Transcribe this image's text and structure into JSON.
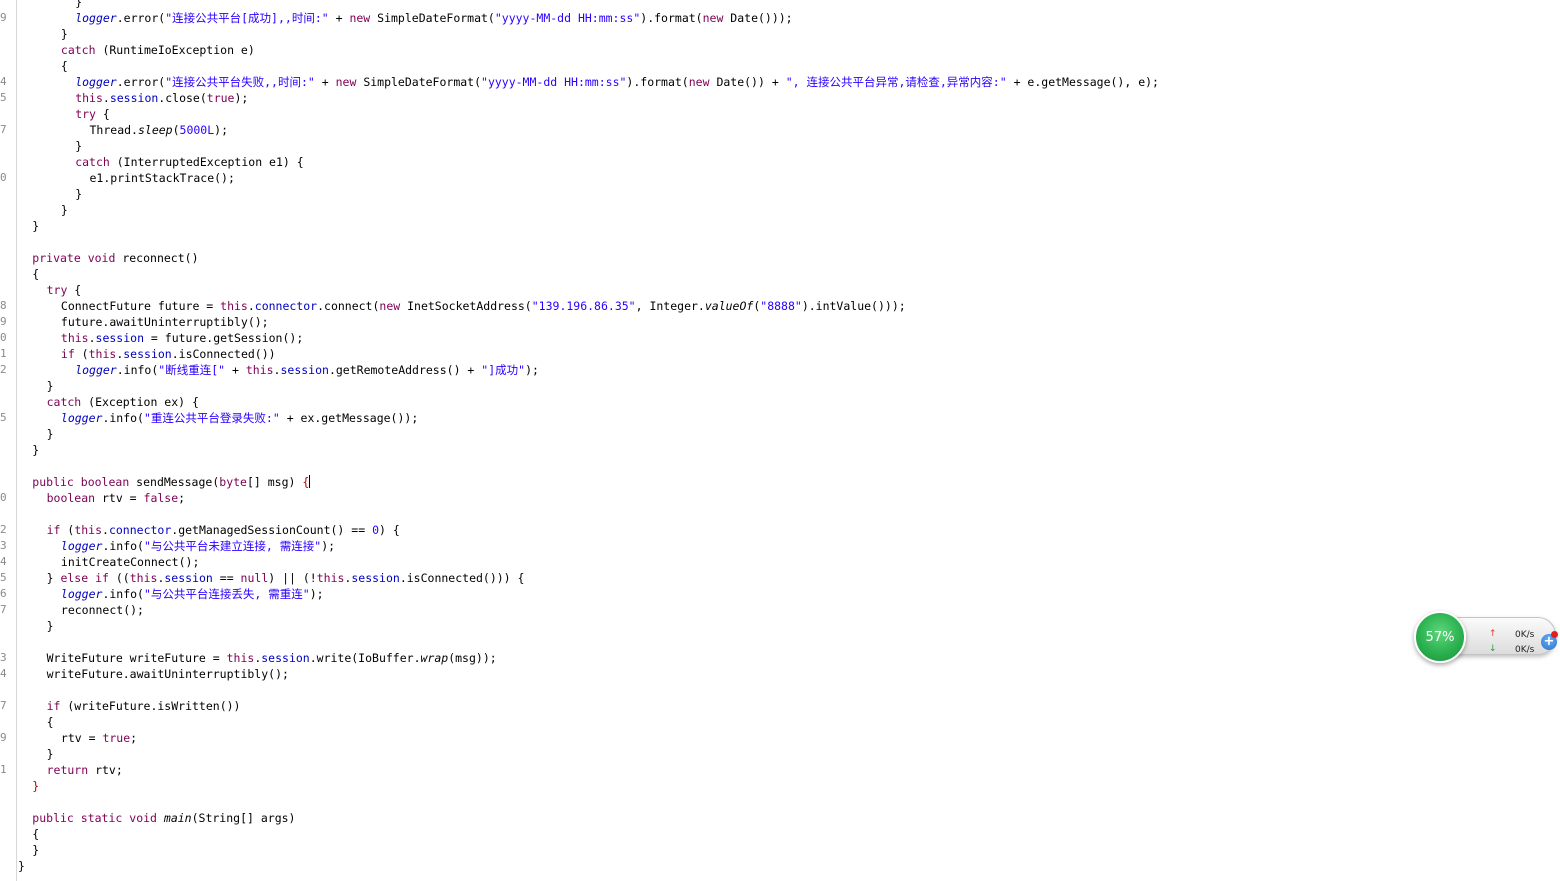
{
  "widget": {
    "usage_percent": "57%",
    "upload_rate": "0K/s",
    "download_rate": "0K/s",
    "colors": {
      "gauge": "#2bb24f",
      "upload_arrow": "#d83a2a",
      "download_arrow": "#2d9a45"
    }
  },
  "editor": {
    "lines": [
      {
        "ln": "",
        "indent": 4,
        "tokens": [
          [
            "",
            "}"
          ]
        ]
      },
      {
        "ln": "9",
        "indent": 4,
        "tokens": [
          [
            "lg",
            "logger"
          ],
          [
            "",
            ".error("
          ],
          [
            "str",
            "\"连接公共平台[成功],,时间:\""
          ],
          [
            "",
            " + "
          ],
          [
            "kw",
            "new"
          ],
          [
            "",
            " SimpleDateFormat("
          ],
          [
            "str",
            "\"yyyy-MM-dd HH:mm:ss\""
          ],
          [
            "",
            ")."
          ],
          [
            "",
            "format("
          ],
          [
            "kw",
            "new"
          ],
          [
            "",
            " Date()));"
          ]
        ]
      },
      {
        "ln": "",
        "indent": 3,
        "tokens": [
          [
            "",
            "}"
          ]
        ]
      },
      {
        "ln": "",
        "indent": 3,
        "tokens": [
          [
            "kw",
            "catch"
          ],
          [
            "",
            " (RuntimeIoException e)"
          ]
        ]
      },
      {
        "ln": "",
        "indent": 3,
        "tokens": [
          [
            "",
            "{"
          ]
        ]
      },
      {
        "ln": "4",
        "indent": 4,
        "tokens": [
          [
            "lg",
            "logger"
          ],
          [
            "",
            ".error("
          ],
          [
            "str",
            "\"连接公共平台失败,,时间:\""
          ],
          [
            "",
            " + "
          ],
          [
            "kw",
            "new"
          ],
          [
            "",
            " SimpleDateFormat("
          ],
          [
            "str",
            "\"yyyy-MM-dd HH:mm:ss\""
          ],
          [
            "",
            ").format("
          ],
          [
            "kw",
            "new"
          ],
          [
            "",
            " Date()) + "
          ],
          [
            "str",
            "\", 连接公共平台异常,请检查,异常内容:\""
          ],
          [
            "",
            " + e.getMessage(), e);"
          ]
        ]
      },
      {
        "ln": "5",
        "indent": 4,
        "tokens": [
          [
            "kw",
            "this"
          ],
          [
            "",
            "."
          ],
          [
            "fld",
            "session"
          ],
          [
            "",
            ".close("
          ],
          [
            "kw",
            "true"
          ],
          [
            "",
            ");"
          ]
        ]
      },
      {
        "ln": "",
        "indent": 4,
        "tokens": [
          [
            "kw",
            "try"
          ],
          [
            "",
            " {"
          ]
        ]
      },
      {
        "ln": "7",
        "indent": 5,
        "tokens": [
          [
            "",
            "Thread."
          ],
          [
            "it",
            "sleep"
          ],
          [
            "",
            "("
          ],
          [
            "str",
            "5000L"
          ],
          [
            "",
            ");"
          ]
        ]
      },
      {
        "ln": "",
        "indent": 4,
        "tokens": [
          [
            "",
            "}"
          ]
        ]
      },
      {
        "ln": "",
        "indent": 4,
        "tokens": [
          [
            "kw",
            "catch"
          ],
          [
            "",
            " (InterruptedException e1) {"
          ]
        ]
      },
      {
        "ln": "0",
        "indent": 5,
        "tokens": [
          [
            "",
            "e1.printStackTrace();"
          ]
        ]
      },
      {
        "ln": "",
        "indent": 4,
        "tokens": [
          [
            "",
            "}"
          ]
        ]
      },
      {
        "ln": "",
        "indent": 3,
        "tokens": [
          [
            "",
            "}"
          ]
        ]
      },
      {
        "ln": "",
        "indent": 1,
        "tokens": [
          [
            "",
            "}"
          ]
        ]
      },
      {
        "ln": "",
        "indent": 0,
        "tokens": []
      },
      {
        "ln": "",
        "indent": 1,
        "tokens": [
          [
            "kw",
            "private"
          ],
          [
            "",
            " "
          ],
          [
            "kw",
            "void"
          ],
          [
            "",
            " reconnect()"
          ]
        ]
      },
      {
        "ln": "",
        "indent": 1,
        "tokens": [
          [
            "",
            "{"
          ]
        ]
      },
      {
        "ln": "",
        "indent": 2,
        "tokens": [
          [
            "kw",
            "try"
          ],
          [
            "",
            " {"
          ]
        ]
      },
      {
        "ln": "8",
        "indent": 3,
        "tokens": [
          [
            "",
            "ConnectFuture future = "
          ],
          [
            "kw",
            "this"
          ],
          [
            "",
            "."
          ],
          [
            "fld",
            "connector"
          ],
          [
            "",
            ".connect("
          ],
          [
            "kw",
            "new"
          ],
          [
            "",
            " InetSocketAddress("
          ],
          [
            "str",
            "\"139.196.86.35\""
          ],
          [
            "",
            ", Integer."
          ],
          [
            "it",
            "valueOf"
          ],
          [
            "",
            "("
          ],
          [
            "str",
            "\"8888\""
          ],
          [
            "",
            ").intValue()));"
          ]
        ]
      },
      {
        "ln": "9",
        "indent": 3,
        "tokens": [
          [
            "",
            "future.awaitUninterruptibly();"
          ]
        ]
      },
      {
        "ln": "0",
        "indent": 3,
        "tokens": [
          [
            "kw",
            "this"
          ],
          [
            "",
            "."
          ],
          [
            "fld",
            "session"
          ],
          [
            "",
            " = future.getSession();"
          ]
        ]
      },
      {
        "ln": "1",
        "indent": 3,
        "tokens": [
          [
            "kw",
            "if"
          ],
          [
            "",
            " ("
          ],
          [
            "kw",
            "this"
          ],
          [
            "",
            "."
          ],
          [
            "fld",
            "session"
          ],
          [
            "",
            ".isConnected())"
          ]
        ]
      },
      {
        "ln": "2",
        "indent": 4,
        "tokens": [
          [
            "lg",
            "logger"
          ],
          [
            "",
            ".info("
          ],
          [
            "str",
            "\"断线重连[\""
          ],
          [
            "",
            " + "
          ],
          [
            "kw",
            "this"
          ],
          [
            "",
            "."
          ],
          [
            "fld",
            "session"
          ],
          [
            "",
            ".getRemoteAddress() + "
          ],
          [
            "str",
            "\"]成功\""
          ],
          [
            "",
            ");"
          ]
        ]
      },
      {
        "ln": "",
        "indent": 2,
        "tokens": [
          [
            "",
            "}"
          ]
        ]
      },
      {
        "ln": "",
        "indent": 2,
        "tokens": [
          [
            "kw",
            "catch"
          ],
          [
            "",
            " (Exception ex) {"
          ]
        ]
      },
      {
        "ln": "5",
        "indent": 3,
        "tokens": [
          [
            "lg",
            "logger"
          ],
          [
            "",
            ".info("
          ],
          [
            "str",
            "\"重连公共平台登录失败:\""
          ],
          [
            "",
            " + ex.getMessage());"
          ]
        ]
      },
      {
        "ln": "",
        "indent": 2,
        "tokens": [
          [
            "",
            "}"
          ]
        ]
      },
      {
        "ln": "",
        "indent": 1,
        "tokens": [
          [
            "",
            "}"
          ]
        ]
      },
      {
        "ln": "",
        "indent": 0,
        "tokens": []
      },
      {
        "ln": "",
        "indent": 1,
        "tokens": [
          [
            "kw",
            "public"
          ],
          [
            "",
            " "
          ],
          [
            "kw",
            "boolean"
          ],
          [
            "",
            " sendMessage("
          ],
          [
            "kw",
            "byte"
          ],
          [
            "",
            "[] msg) "
          ],
          [
            "br",
            "{"
          ],
          [
            "caret",
            ""
          ]
        ]
      },
      {
        "ln": "0",
        "indent": 2,
        "tokens": [
          [
            "kw",
            "boolean"
          ],
          [
            "",
            " rtv = "
          ],
          [
            "kw",
            "false"
          ],
          [
            "",
            ";"
          ]
        ]
      },
      {
        "ln": "",
        "indent": 0,
        "tokens": []
      },
      {
        "ln": "2",
        "indent": 2,
        "tokens": [
          [
            "kw",
            "if"
          ],
          [
            "",
            " ("
          ],
          [
            "kw",
            "this"
          ],
          [
            "",
            "."
          ],
          [
            "fld",
            "connector"
          ],
          [
            "",
            ".getManagedSessionCount() == "
          ],
          [
            "str",
            "0"
          ],
          [
            "",
            ") {"
          ]
        ]
      },
      {
        "ln": "3",
        "indent": 3,
        "tokens": [
          [
            "lg",
            "logger"
          ],
          [
            "",
            ".info("
          ],
          [
            "str",
            "\"与公共平台未建立连接, 需连接\""
          ],
          [
            "",
            ");"
          ]
        ]
      },
      {
        "ln": "4",
        "indent": 3,
        "tokens": [
          [
            "",
            "initCreateConnect();"
          ]
        ]
      },
      {
        "ln": "5",
        "indent": 2,
        "tokens": [
          [
            "",
            "} "
          ],
          [
            "kw",
            "else"
          ],
          [
            "",
            " "
          ],
          [
            "kw",
            "if"
          ],
          [
            "",
            " (("
          ],
          [
            "kw",
            "this"
          ],
          [
            "",
            "."
          ],
          [
            "fld",
            "session"
          ],
          [
            "",
            " == "
          ],
          [
            "kw",
            "null"
          ],
          [
            "",
            ") || (!"
          ],
          [
            "kw",
            "this"
          ],
          [
            "",
            "."
          ],
          [
            "fld",
            "session"
          ],
          [
            "",
            ".isConnected())) {"
          ]
        ]
      },
      {
        "ln": "6",
        "indent": 3,
        "tokens": [
          [
            "lg",
            "logger"
          ],
          [
            "",
            ".info("
          ],
          [
            "str",
            "\"与公共平台连接丢失, 需重连\""
          ],
          [
            "",
            ");"
          ]
        ]
      },
      {
        "ln": "7",
        "indent": 3,
        "tokens": [
          [
            "",
            "reconnect();"
          ]
        ]
      },
      {
        "ln": "",
        "indent": 2,
        "tokens": [
          [
            "",
            "}"
          ]
        ]
      },
      {
        "ln": "",
        "indent": 0,
        "tokens": []
      },
      {
        "ln": "3",
        "indent": 2,
        "tokens": [
          [
            "",
            "WriteFuture writeFuture = "
          ],
          [
            "kw",
            "this"
          ],
          [
            "",
            "."
          ],
          [
            "fld",
            "session"
          ],
          [
            "",
            ".write(IoBuffer."
          ],
          [
            "it",
            "wrap"
          ],
          [
            "",
            "(msg));"
          ]
        ]
      },
      {
        "ln": "4",
        "indent": 2,
        "tokens": [
          [
            "",
            "writeFuture.awaitUninterruptibly();"
          ]
        ]
      },
      {
        "ln": "",
        "indent": 0,
        "tokens": []
      },
      {
        "ln": "7",
        "indent": 2,
        "tokens": [
          [
            "kw",
            "if"
          ],
          [
            "",
            " (writeFuture.isWritten())"
          ]
        ]
      },
      {
        "ln": "",
        "indent": 2,
        "tokens": [
          [
            "",
            "{"
          ]
        ]
      },
      {
        "ln": "9",
        "indent": 3,
        "tokens": [
          [
            "",
            "rtv = "
          ],
          [
            "kw",
            "true"
          ],
          [
            "",
            ";"
          ]
        ]
      },
      {
        "ln": "",
        "indent": 2,
        "tokens": [
          [
            "",
            "}"
          ]
        ]
      },
      {
        "ln": "1",
        "indent": 2,
        "tokens": [
          [
            "kw",
            "return"
          ],
          [
            "",
            " rtv;"
          ]
        ]
      },
      {
        "ln": "",
        "indent": 1,
        "tokens": [
          [
            "br",
            "}"
          ]
        ]
      },
      {
        "ln": "",
        "indent": 0,
        "tokens": []
      },
      {
        "ln": "",
        "indent": 1,
        "tokens": [
          [
            "kw",
            "public"
          ],
          [
            "",
            " "
          ],
          [
            "kw",
            "static"
          ],
          [
            "",
            " "
          ],
          [
            "kw",
            "void"
          ],
          [
            "",
            " "
          ],
          [
            "it",
            "main"
          ],
          [
            "",
            "(String[] args)"
          ]
        ]
      },
      {
        "ln": "",
        "indent": 1,
        "tokens": [
          [
            "",
            "{"
          ]
        ]
      },
      {
        "ln": "",
        "indent": 1,
        "tokens": [
          [
            "",
            "}"
          ]
        ]
      },
      {
        "ln": "",
        "indent": 0,
        "tokens": [
          [
            "",
            "}"
          ]
        ]
      }
    ]
  }
}
